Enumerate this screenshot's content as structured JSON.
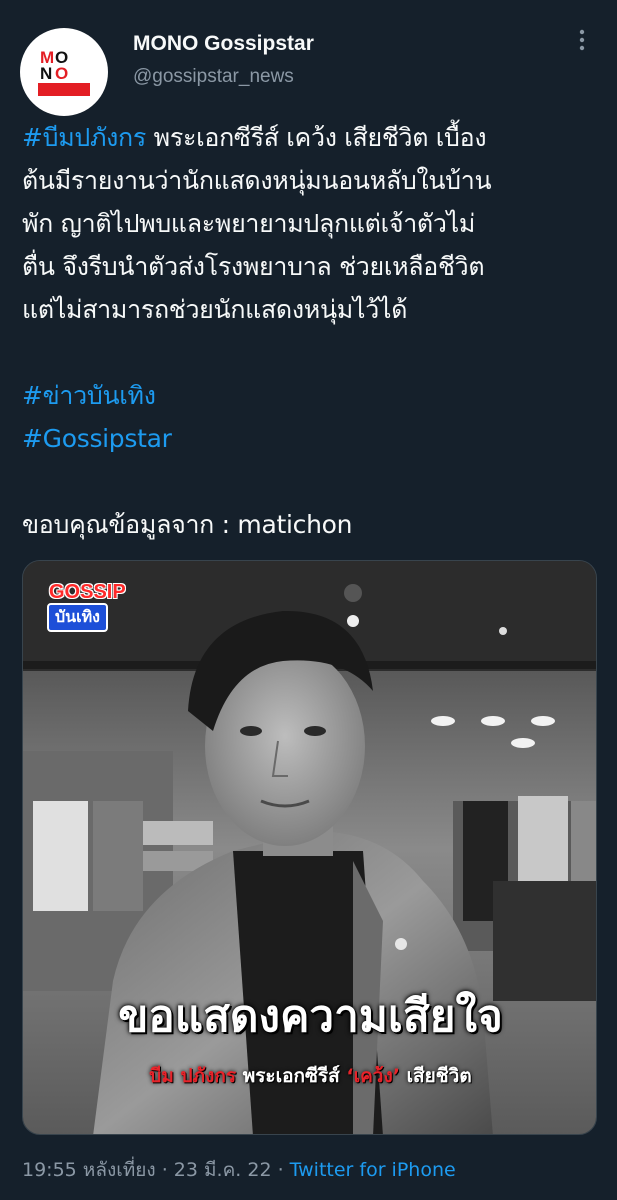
{
  "author": {
    "name": "MONO Gossipstar",
    "handle": "@gossipstar_news",
    "avatar_logo": {
      "line1": "MONO",
      "line2": "GOSSIP",
      "colors": {
        "mono_red": "#e31e24",
        "gossip_bg": "#e31e24"
      }
    }
  },
  "tweet": {
    "hashtag1": "#บีมปภังกร",
    "line1_rest": " พระเอกซีรีส์ เคว้ง เสียชีวิต เบื้อง",
    "line2": "ต้นมีรายงานว่านักแสดงหนุ่มนอนหลับในบ้าน",
    "line3": "พัก ญาติไปพบและพยายามปลุกแต่เจ้าตัวไม่",
    "line4": "ตื่น จึงรีบนำตัวส่งโรงพยาบาล ช่วยเหลือชีวิต",
    "line5": "แต่ไม่สามารถช่วยนักแสดงหนุ่มไว้ได้",
    "hashtag2": "#ข่าวบันเทิง",
    "hashtag3": "#Gossipstar",
    "credit": "ขอบคุณข้อมูลจาก : matichon"
  },
  "media": {
    "badge_top": "GOSSIP",
    "badge_bottom": "บันเทิง",
    "caption_main": "ขอแสดงความเสียใจ",
    "caption_name": "บีม ปภังกร",
    "caption_mid": " พระเอกซีรีส์ ",
    "caption_series": "‘เคว้ง’",
    "caption_end": " เสียชีวิต"
  },
  "meta": {
    "time": "19:55 หลังเที่ยง",
    "sep1": " · ",
    "date": "23 มี.ค. 22",
    "sep2": " · ",
    "source": "Twitter for iPhone"
  },
  "colors": {
    "background": "#15202b",
    "text": "#f7f9f9",
    "secondary": "#8b98a5",
    "link": "#1d9bf0"
  }
}
